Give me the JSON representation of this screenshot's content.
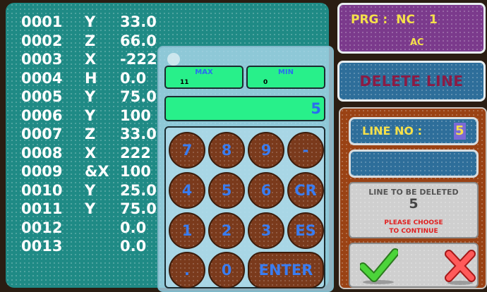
{
  "program": {
    "lines": [
      {
        "num": "0001",
        "axis": "Y",
        "value": "33.0"
      },
      {
        "num": "0002",
        "axis": "Z",
        "value": "66.0"
      },
      {
        "num": "0003",
        "axis": "X",
        "value": "-222"
      },
      {
        "num": "0004",
        "axis": "H",
        "value": "0.0"
      },
      {
        "num": "0005",
        "axis": "Y",
        "value": "75.0"
      },
      {
        "num": "0006",
        "axis": "Y",
        "value": "100"
      },
      {
        "num": "0007",
        "axis": "Z",
        "value": "33.0"
      },
      {
        "num": "0008",
        "axis": "X",
        "value": "222"
      },
      {
        "num": "0009",
        "axis": "&X",
        "value": "100"
      },
      {
        "num": "0010",
        "axis": "Y",
        "value": "25.0"
      },
      {
        "num": "0011",
        "axis": "Y",
        "value": "75.0"
      },
      {
        "num": "0012",
        "axis": "",
        "value": "0.0"
      },
      {
        "num": "0013",
        "axis": "",
        "value": "0.0"
      }
    ]
  },
  "keypad": {
    "max_label": "MAX",
    "max_value": "11",
    "min_label": "MIN",
    "min_value": "0",
    "entry_value": "5",
    "keys": {
      "k7": "7",
      "k8": "8",
      "k9": "9",
      "dash": "-",
      "k4": "4",
      "k5": "5",
      "k6": "6",
      "cr": "CR",
      "k1": "1",
      "k2": "2",
      "k3": "3",
      "es": "ES",
      "dot": ".",
      "k0": "0",
      "enter": "ENTER"
    }
  },
  "header": {
    "prg_label": "PRG :",
    "nc_label": "NC",
    "prg_number": "1",
    "sub_label": "AC"
  },
  "delete_line_label": "DELETE LINE",
  "line_no": {
    "label": "LINE NO :",
    "value": "5"
  },
  "confirm": {
    "title": "LINE TO BE DELETED",
    "value": "5",
    "hint_line1": "PLEASE CHOOSE",
    "hint_line2": "TO CONTINUE"
  },
  "icons": {
    "ok": "checkmark-icon",
    "cancel": "cross-icon"
  },
  "colors": {
    "program_bg": "#1f8a85",
    "key_bg": "#7a3a1c",
    "key_text": "#3a7cf0",
    "field_bg": "#28f08a",
    "accent_yellow": "#f5e04a",
    "header_bg": "#7b3a8c",
    "delete_text": "#8a1c45",
    "warning": "#e02020"
  }
}
